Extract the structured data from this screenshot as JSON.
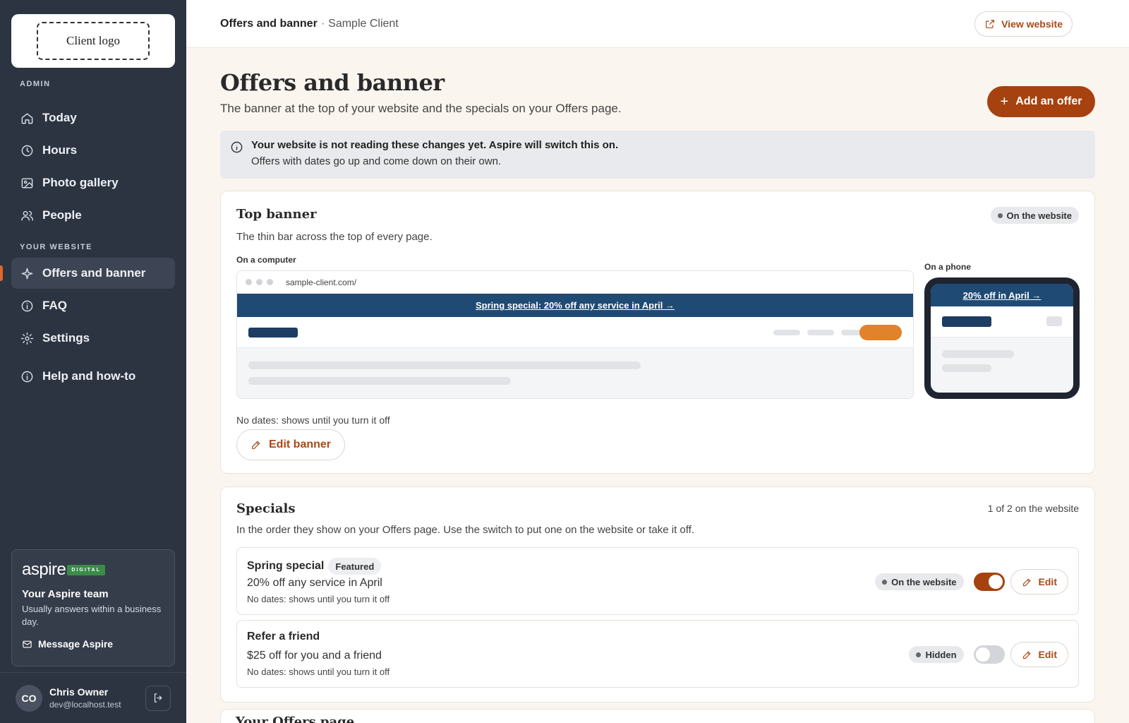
{
  "sidebar": {
    "logo_text": "Client logo",
    "admin_label": "ADMIN",
    "admin_items": [
      {
        "label": "Today",
        "icon": "home-icon"
      },
      {
        "label": "Hours",
        "icon": "clock-icon"
      },
      {
        "label": "Photo gallery",
        "icon": "image-icon"
      },
      {
        "label": "People",
        "icon": "people-icon"
      }
    ],
    "website_label": "YOUR WEBSITE",
    "website_items": [
      {
        "label": "Offers and banner",
        "icon": "sparkle-icon",
        "active": true
      },
      {
        "label": "FAQ",
        "icon": "info-icon"
      },
      {
        "label": "Settings",
        "icon": "gear-icon"
      }
    ],
    "help_item": {
      "label": "Help and how-to",
      "icon": "info-icon"
    },
    "aspire": {
      "logo_word": "aspire",
      "logo_tag": "DIGITAL",
      "title": "Your Aspire team",
      "subtitle": "Usually answers within a business day.",
      "message_label": "Message Aspire"
    },
    "user": {
      "initials": "CO",
      "name": "Chris Owner",
      "email": "dev@localhost.test"
    }
  },
  "topbar": {
    "crumb_main": "Offers and banner",
    "crumb_sep": "·",
    "crumb_sub": "Sample Client",
    "view_website_label": "View website"
  },
  "header": {
    "title": "Offers and banner",
    "subtitle": "The banner at the top of your website and the specials on your Offers page.",
    "add_offer_label": "Add an offer"
  },
  "notice": {
    "strong": "Your website is not reading these changes yet. Aspire will switch this on.",
    "text": "Offers with dates go up and come down on their own."
  },
  "top_banner": {
    "title": "Top banner",
    "status": "On the website",
    "subtitle": "The thin bar across the top of every page.",
    "computer_label": "On a computer",
    "phone_label": "On a phone",
    "url": "sample-client.com/",
    "desktop_banner_text": "Spring special: 20% off any service in April →",
    "phone_banner_text": "20% off in April →",
    "dates_text": "No dates: shows until you turn it off",
    "edit_label": "Edit banner"
  },
  "specials": {
    "title": "Specials",
    "count_text": "1 of 2 on the website",
    "subtitle": "In the order they show on your Offers page. Use the switch to put one on the website or take it off.",
    "items": [
      {
        "title": "Spring special",
        "badge": "Featured",
        "description": "20% off any service in April",
        "dates": "No dates: shows until you turn it off",
        "status": "On the website",
        "enabled": true,
        "edit_label": "Edit"
      },
      {
        "title": "Refer a friend",
        "badge": "",
        "description": "$25 off for you and a friend",
        "dates": "No dates: shows until you turn it off",
        "status": "Hidden",
        "enabled": false,
        "edit_label": "Edit"
      }
    ]
  },
  "next_section_title": "Your Offers page"
}
